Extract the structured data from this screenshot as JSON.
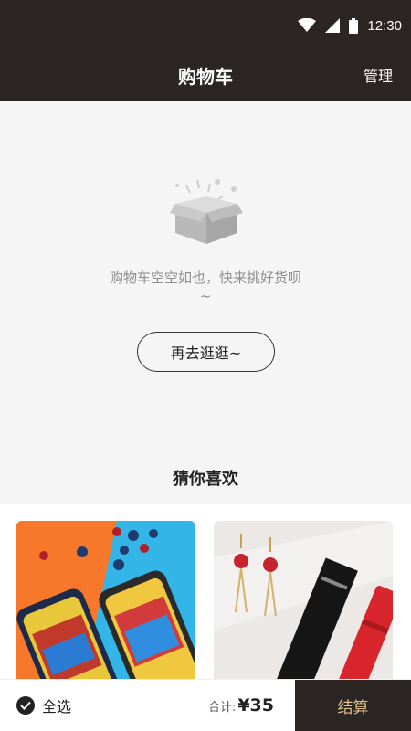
{
  "status_bar": {
    "time": "12:30"
  },
  "header": {
    "title": "购物车",
    "action": "管理"
  },
  "empty_state": {
    "message": "购物车空空如也，快来挑好货呗",
    "message_tail": "~",
    "button_label": "再去逛逛~"
  },
  "recommend": {
    "title": "猜你喜欢"
  },
  "bottom_bar": {
    "select_all_label": "全选",
    "total_label": "合计:",
    "total_value": "¥35",
    "checkout_label": "结算"
  },
  "colors": {
    "header_bg": "#2b2624",
    "checkout_text": "#e2c08a"
  }
}
